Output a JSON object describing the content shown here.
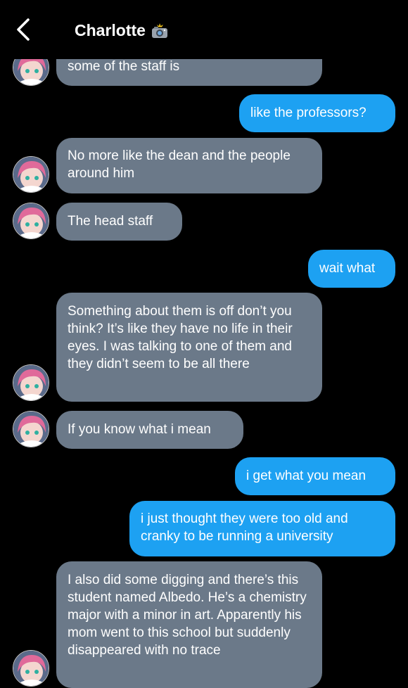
{
  "header": {
    "title": "Charlotte",
    "title_icon": "camera-flash-icon",
    "back_icon": "chevron-left-icon"
  },
  "colors": {
    "background": "#000000",
    "incoming_bubble": "#6b7989",
    "outgoing_bubble": "#1da1f2"
  },
  "messages": [
    {
      "from": "Charlotte",
      "text": "some of the staff is"
    },
    {
      "from": "me",
      "text": "like the professors?"
    },
    {
      "from": "Charlotte",
      "text": "No more like the dean and the people around him"
    },
    {
      "from": "Charlotte",
      "text": "The head staff"
    },
    {
      "from": "me",
      "text": "wait what"
    },
    {
      "from": "Charlotte",
      "text": "Something about them is off don’t you think? It’s like they have no life in their eyes. I was talking to one of them and they didn’t seem to be all there"
    },
    {
      "from": "Charlotte",
      "text": "If you know what i mean"
    },
    {
      "from": "me",
      "text": "i get what you mean"
    },
    {
      "from": "me",
      "text": "i just thought they were too old and cranky to be running a university"
    },
    {
      "from": "Charlotte",
      "text": "I also did some digging and there’s this student named Albedo. He’s a chemistry major with a minor in art. Apparently his mom went to this school but suddenly disappeared with no trace"
    }
  ]
}
